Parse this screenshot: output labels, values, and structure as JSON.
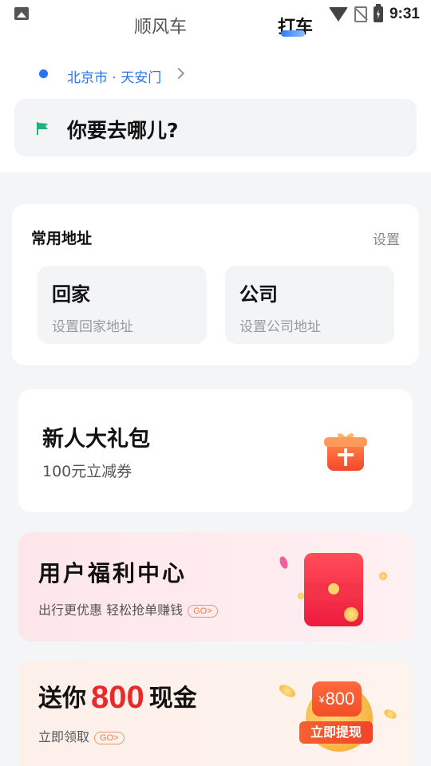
{
  "status_bar": {
    "time": "9:31",
    "icons": [
      "image-icon",
      "wifi-icon",
      "no-sim-icon",
      "battery-charging-icon"
    ]
  },
  "tabs": [
    {
      "label": "顺风车",
      "active": false
    },
    {
      "label": "打车",
      "active": true
    }
  ],
  "location": {
    "text": "北京市 · 天安门",
    "dot_color": "#2b73ec"
  },
  "destination": {
    "placeholder": "你要去哪儿?",
    "icon": "flag-icon",
    "icon_color": "#1bb479"
  },
  "common_addresses": {
    "title": "常用地址",
    "setting_label": "设置",
    "items": [
      {
        "title": "回家",
        "subtitle": "设置回家地址"
      },
      {
        "title": "公司",
        "subtitle": "设置公司地址"
      }
    ]
  },
  "new_user_promo": {
    "title": "新人大礼包",
    "subtitle": "100元立减券",
    "icon": "gift-icon"
  },
  "welfare_center": {
    "title": "用户福利中心",
    "subtitle": "出行更优惠  轻松抢单赚钱",
    "go_label": "GO>",
    "icon": "red-packet-icon"
  },
  "cash_promo": {
    "title_prefix": "送你",
    "amount": "800",
    "title_suffix": "现金",
    "subtitle": "立即领取",
    "go_label": "GO>",
    "badge_currency": "¥",
    "badge_amount": "800",
    "withdraw_label": "立即提现"
  },
  "colors": {
    "accent_blue": "#2b73ec",
    "promo_red": "#e82a2a",
    "background": "#f4f5f7"
  }
}
